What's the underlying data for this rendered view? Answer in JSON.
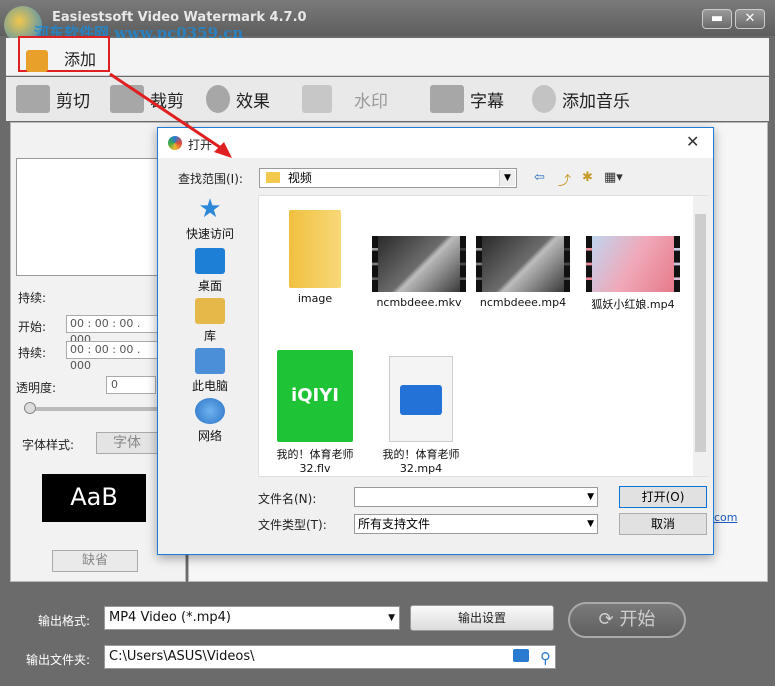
{
  "window": {
    "title": "Easiestsoft Video Watermark 4.7.0",
    "minimize": "▬",
    "close": "✕"
  },
  "watermark_text": "河东软件网 www.pc0359.cn",
  "add_button": {
    "label": "添加"
  },
  "toolbar": {
    "cut": "剪切",
    "crop": "裁剪",
    "effect": "效果",
    "watermark": "水印",
    "subtitle": "字幕",
    "music": "添加音乐"
  },
  "left_panel": {
    "duration1_label": "持续:",
    "start_label": "开始:",
    "duration2_label": "持续:",
    "start_value": "00 : 00 : 00 . 000",
    "duration_value": "00 : 00 : 00 . 000",
    "opacity_label": "透明度:",
    "opacity_value": "0",
    "opacity_level": 0,
    "font_style_label": "字体样式:",
    "font_button": "字体",
    "font_preview": "AaB",
    "default_button": "缺省"
  },
  "right_panel": {
    "link_fragment": "com"
  },
  "dialog": {
    "title": "打开",
    "look_in_label": "查找范围(I):",
    "look_in_value": "视频",
    "places": [
      {
        "label": "快速访问",
        "icon": "star-icon"
      },
      {
        "label": "桌面",
        "icon": "desktop-icon"
      },
      {
        "label": "库",
        "icon": "library-icon"
      },
      {
        "label": "此电脑",
        "icon": "computer-icon"
      },
      {
        "label": "网络",
        "icon": "network-icon"
      }
    ],
    "files": [
      {
        "name": "image",
        "icon": "folder-icon"
      },
      {
        "name": "ncmbdeee.mkv",
        "icon": "video-thumbnail"
      },
      {
        "name": "ncmbdeee.mp4",
        "icon": "video-thumbnail"
      },
      {
        "name": "狐妖小红娘.mp4",
        "icon": "video-thumbnail"
      },
      {
        "name": "我的！体育老师32.flv",
        "icon": "iqiyi-icon",
        "icon_text": "iQIYI"
      },
      {
        "name": "我的！体育老师32.mp4",
        "icon": "video-file-icon"
      }
    ],
    "filename_label": "文件名(N):",
    "filename_value": "",
    "filetype_label": "文件类型(T):",
    "filetype_value": "所有支持文件",
    "open_button": "打开(O)",
    "cancel_button": "取消"
  },
  "bottom": {
    "format_label": "输出格式:",
    "format_value": "MP4 Video (*.mp4)",
    "settings_button": "输出设置",
    "folder_label": "输出文件夹:",
    "folder_value": "C:\\Users\\ASUS\\Videos\\",
    "start_button": "开始"
  },
  "colors": {
    "highlight": "#e02020",
    "dialog_border": "#1e7bd6",
    "iqiyi": "#1fc436"
  }
}
